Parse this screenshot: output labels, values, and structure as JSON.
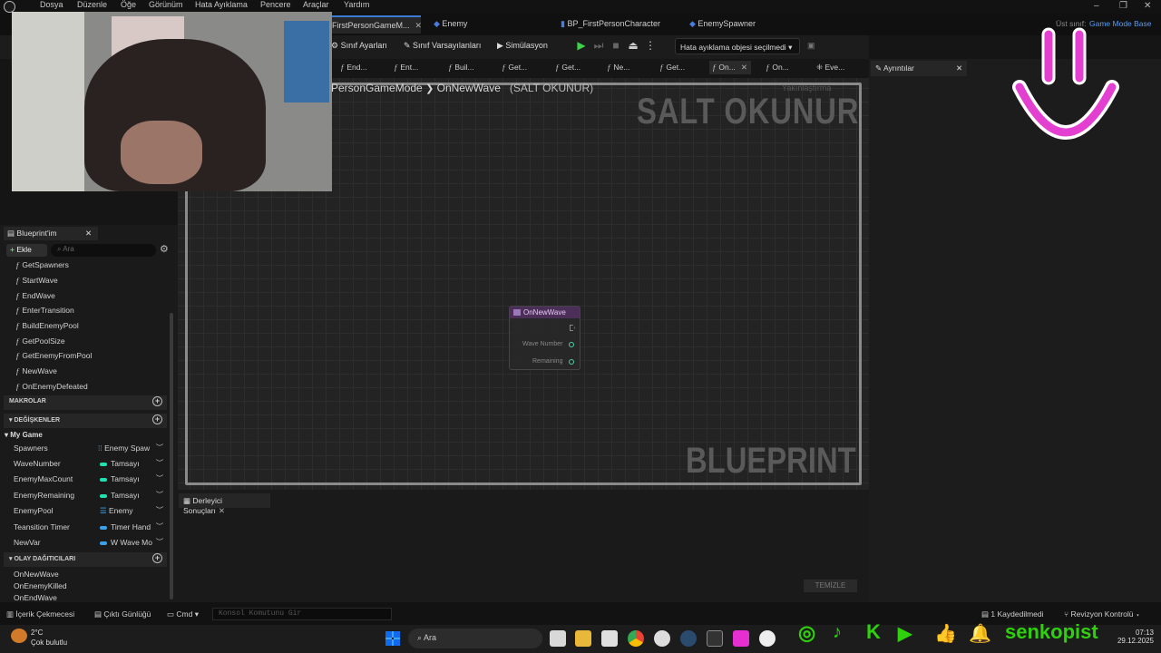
{
  "menu": [
    "Dosya",
    "Düzenle",
    "Öğe",
    "Görünüm",
    "Hata Ayıklama",
    "Pencere",
    "Araçlar",
    "Yardım"
  ],
  "tabs": [
    {
      "label": "FirstPersonGameM...",
      "active": true
    },
    {
      "label": "Enemy",
      "active": false
    },
    {
      "label": "BP_FirstPersonCharacter",
      "active": false
    },
    {
      "label": "EnemySpawner",
      "active": false
    }
  ],
  "parent_class": {
    "label": "Üst sınıf:",
    "value": "Game Mode Base"
  },
  "toolbar": {
    "class_settings": "Sınıf Ayarları",
    "class_defaults": "Sınıf Varsayılanları",
    "simulation": "Simülasyon",
    "debug_select": "Hata ayıklama objesi seçilmedi"
  },
  "fn_tabs": [
    "End...",
    "Ent...",
    "Buil...",
    "Get...",
    "Get...",
    "Ne...",
    "Get...",
    "On...",
    "On...",
    "Eve..."
  ],
  "details_tab": "Ayrıntılar",
  "graph": {
    "breadcrumb_parent": "PersonGameMode",
    "breadcrumb_current": "OnNewWave",
    "readonly_label": "(SALT OKUNUR)",
    "zoom_text": "Yakınlaştırma",
    "watermark_top": "SALT OKUNUR",
    "watermark_bottom": "BLUEPRINT"
  },
  "node": {
    "title": "OnNewWave",
    "pins": [
      "Wave Number",
      "Remaining"
    ]
  },
  "compiler": {
    "tab": "Derleyici Sonuçları",
    "clear": "TEMİZLE"
  },
  "my_blueprint": {
    "title": "Blueprint'im",
    "add": "Ekle",
    "search_placeholder": "Ara",
    "functions": [
      "GetSpawners",
      "StartWave",
      "EndWave",
      "EnterTransition",
      "BuildEnemyPool",
      "GetPoolSize",
      "GetEnemyFromPool",
      "NewWave",
      "OnEnemyDefeated"
    ],
    "macros": "MAKROLAR",
    "variables_header": "DEĞİŞKENLER",
    "category": "My Game",
    "variables": [
      {
        "name": "Spawners",
        "type": "Enemy Spaw",
        "color": "#3aa0e8"
      },
      {
        "name": "WaveNumber",
        "type": "Tamsayı",
        "color": "#1fe0b0"
      },
      {
        "name": "EnemyMaxCount",
        "type": "Tamsayı",
        "color": "#1fe0b0"
      },
      {
        "name": "EnemyRemaining",
        "type": "Tamsayı",
        "color": "#1fe0b0"
      },
      {
        "name": "EnemyPool",
        "type": "Enemy",
        "color": "#3aa0e8"
      },
      {
        "name": "Teansition Timer",
        "type": "Timer Hand",
        "color": "#3aa0e8"
      },
      {
        "name": "NewVar",
        "type": "W Wave Mo",
        "color": "#3aa0e8"
      }
    ],
    "dispatchers_header": "OLAY DAĞITICILARI",
    "dispatchers": [
      "OnNewWave",
      "OnEnemyKilled",
      "OnEndWave"
    ]
  },
  "statusbar": {
    "content_drawer": "İçerik Çekmecesi",
    "output_log": "Çıktı Günlüğü",
    "cmd": "Cmd",
    "console_placeholder": "Konsol Komutunu Gir",
    "saved": "1 Kaydedilmedi",
    "revision": "Revizyon Kontrolü"
  },
  "taskbar": {
    "weather_temp": "2°C",
    "weather_desc": "Çok bulutlu",
    "search": "Ara",
    "time": "07:13",
    "date": "29.12.2025"
  },
  "overlay": {
    "channel": "senkopist"
  }
}
